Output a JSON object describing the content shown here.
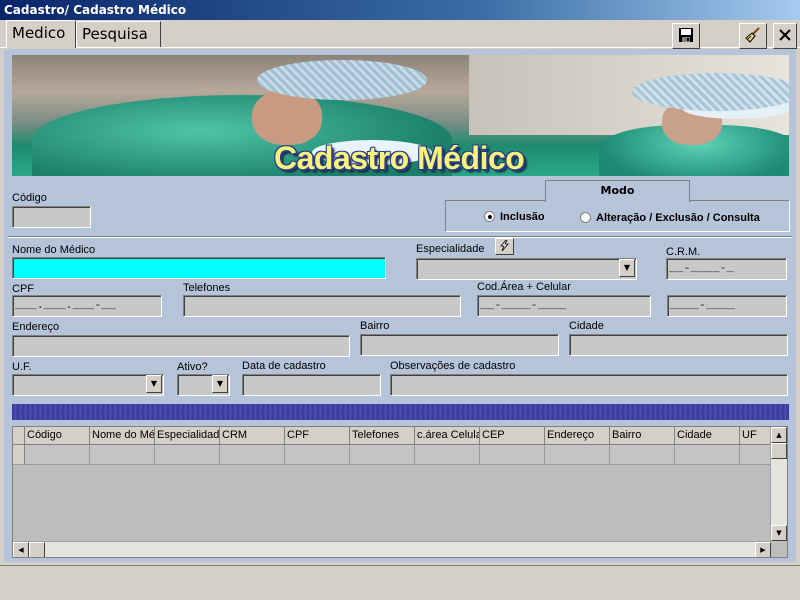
{
  "window": {
    "title": "Cadastro/ Cadastro Médico"
  },
  "tabs": [
    {
      "label": "Medico",
      "active": true
    },
    {
      "label": "Pesquisa",
      "active": false
    }
  ],
  "toolbar": {
    "save_icon": "floppy-disk-icon",
    "clear_icon": "broom-icon",
    "close_icon": "close-icon"
  },
  "banner": {
    "title": "Cadastro Médico"
  },
  "form": {
    "codigo": {
      "label": "Código",
      "value": ""
    },
    "modo": {
      "label": "Modo",
      "options": [
        "Inclusão",
        "Alteração / Exclusão / Consulta"
      ],
      "selected": "Inclusão"
    },
    "nome": {
      "label": "Nome do Médico",
      "value": ""
    },
    "especialidade": {
      "label": "Especialidade",
      "value": ""
    },
    "crm": {
      "label": "C.R.M.",
      "mask": "__-____-_"
    },
    "cpf": {
      "label": "CPF",
      "mask": "___.___.___-__"
    },
    "telefones": {
      "label": "Telefones",
      "value": ""
    },
    "celular": {
      "label": "Cod.Área + Celular",
      "mask_area": "__-____-____",
      "mask_num": "____-____"
    },
    "endereco": {
      "label": "Endereço",
      "value": ""
    },
    "bairro": {
      "label": "Bairro",
      "value": ""
    },
    "cidade": {
      "label": "Cidade",
      "value": ""
    },
    "uf": {
      "label": "U.F.",
      "value": ""
    },
    "ativo": {
      "label": "Ativo?",
      "value": ""
    },
    "data_cadastro": {
      "label": "Data de cadastro",
      "value": ""
    },
    "observacoes": {
      "label": "Observações de cadastro",
      "value": ""
    }
  },
  "grid": {
    "columns": [
      "Código",
      "Nome do Mé",
      "Especialidad",
      "CRM",
      "CPF",
      "Telefones",
      "c.área Celula",
      "CEP",
      "Endereço",
      "Bairro",
      "Cidade",
      "UF"
    ]
  },
  "colors": {
    "panel": "#b5c4d9",
    "highlight_field": "#00ffff",
    "bar": "#40429e",
    "titlebar": "#0a246a"
  }
}
